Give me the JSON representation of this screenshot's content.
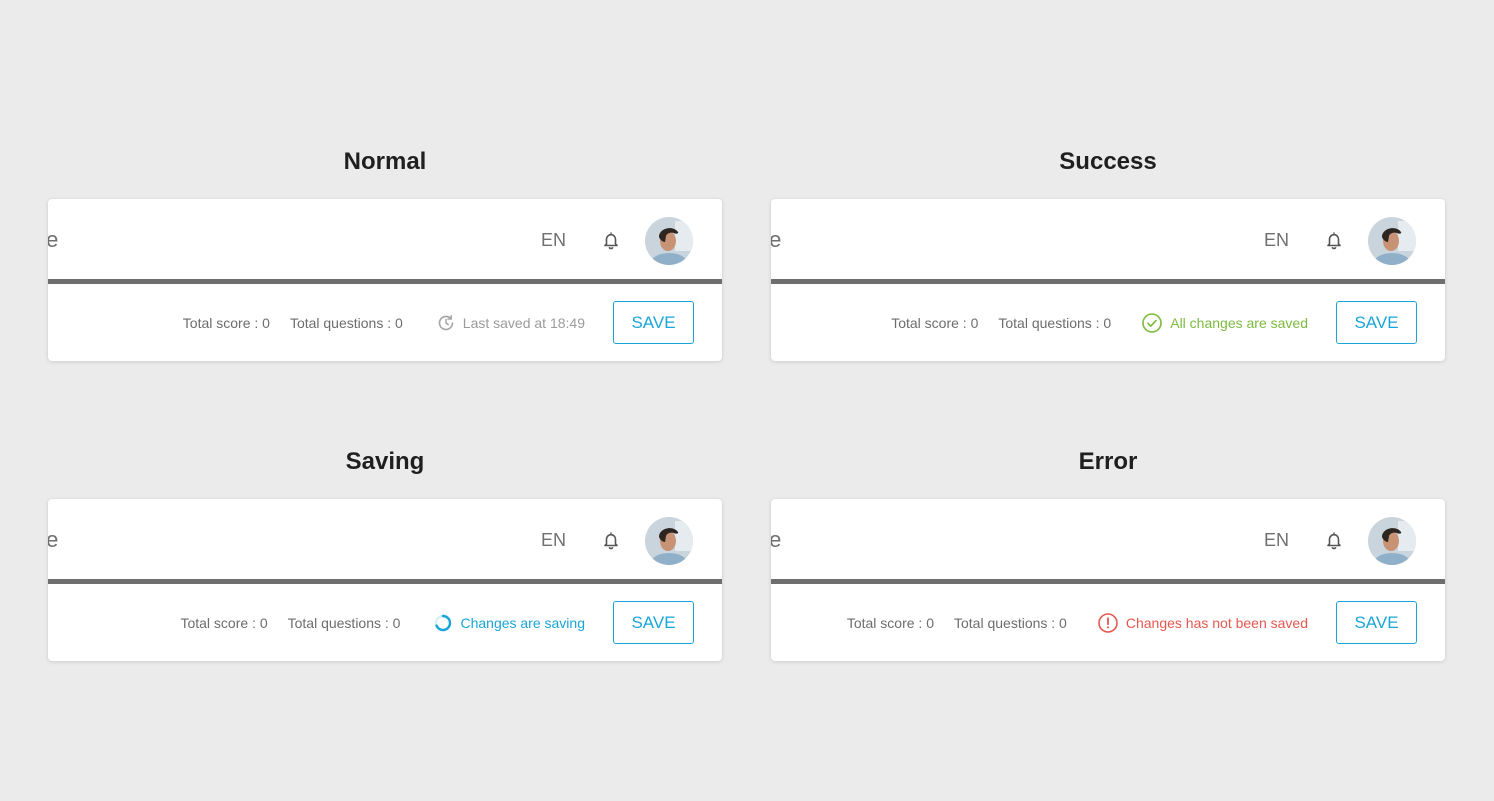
{
  "states": [
    {
      "title": "Normal",
      "app_title": "sole",
      "lang": "EN",
      "total_score": "Total score : 0",
      "total_questions": "Total questions : 0",
      "status_text": "Last saved at 18:49",
      "status_icon": "history-icon",
      "save_label": "SAVE"
    },
    {
      "title": "Success",
      "app_title": "sole",
      "lang": "EN",
      "total_score": "Total score : 0",
      "total_questions": "Total questions : 0",
      "status_text": "All changes are saved",
      "status_icon": "check-circle-icon",
      "save_label": "SAVE"
    },
    {
      "title": "Saving",
      "app_title": "sole",
      "lang": "EN",
      "total_score": "Total score : 0",
      "total_questions": "Total questions : 0",
      "status_text": "Changes are saving",
      "status_icon": "spinner-icon",
      "save_label": "SAVE"
    },
    {
      "title": "Error",
      "app_title": "sole",
      "lang": "EN",
      "total_score": "Total score : 0",
      "total_questions": "Total questions : 0",
      "status_text": "Changes has not been saved",
      "status_icon": "alert-circle-icon",
      "save_label": "SAVE"
    }
  ],
  "colors": {
    "accent": "#1aa5d8",
    "success": "#7cbb3f",
    "error": "#e4584f",
    "muted": "#9b9b9b",
    "background": "#ebebeb"
  }
}
